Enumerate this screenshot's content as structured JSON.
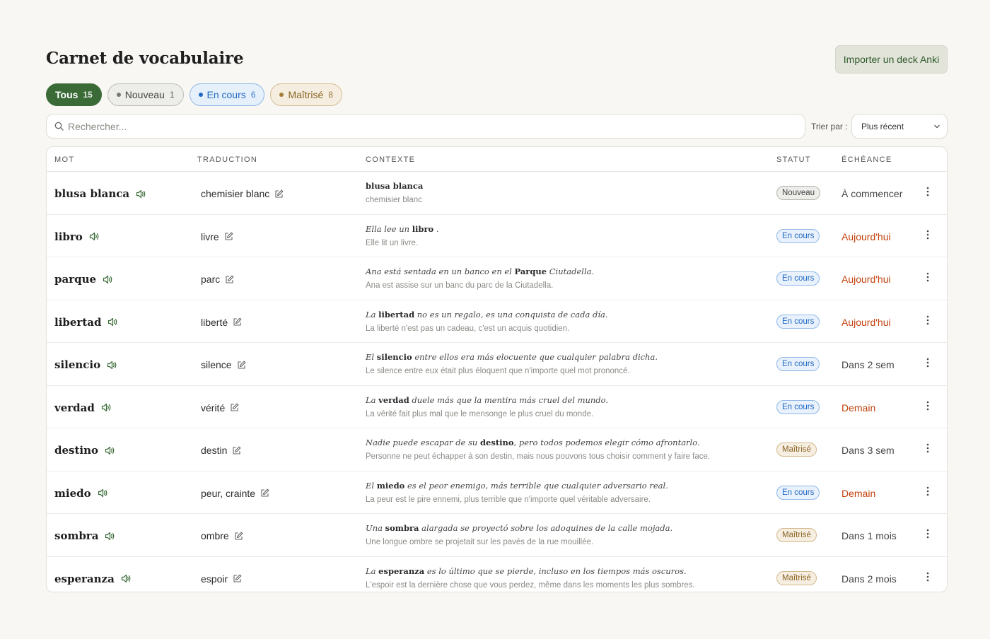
{
  "header": {
    "title": "Carnet de vocabulaire",
    "import_label": "Importer un deck Anki"
  },
  "filters": [
    {
      "label": "Tous",
      "count": "15"
    },
    {
      "label": "Nouveau",
      "count": "1"
    },
    {
      "label": "En cours",
      "count": "6"
    },
    {
      "label": "Maîtrisé",
      "count": "8"
    }
  ],
  "search": {
    "placeholder": "Rechercher..."
  },
  "sort": {
    "label": "Trier par :",
    "value": "Plus récent"
  },
  "columns": [
    "MOT",
    "TRADUCTION",
    "CONTEXTE",
    "STATUT",
    "ÉCHÉANCE"
  ],
  "rows": [
    {
      "word": "blusa blanca",
      "translation": "chemisier blanc",
      "ctx_pre": "",
      "ctx_word": "blusa blanca",
      "ctx_post": "",
      "ctx_fr": "chemisier blanc",
      "status": "Nouveau",
      "due": "À commencer"
    },
    {
      "word": "libro",
      "translation": "livre",
      "ctx_pre": "Ella lee un ",
      "ctx_word": "libro",
      "ctx_post": " .",
      "ctx_fr": "Elle lit un livre.",
      "status": "En cours",
      "due": "Aujourd'hui"
    },
    {
      "word": "parque",
      "translation": "parc",
      "ctx_pre": "Ana está sentada en un banco en el ",
      "ctx_word": "Parque",
      "ctx_post": " Ciutadella.",
      "ctx_fr": "Ana est assise sur un banc du parc de la Ciutadella.",
      "status": "En cours",
      "due": "Aujourd'hui"
    },
    {
      "word": "libertad",
      "translation": "liberté",
      "ctx_pre": "La ",
      "ctx_word": "libertad",
      "ctx_post": " no es un regalo, es una conquista de cada día.",
      "ctx_fr": "La liberté n'est pas un cadeau, c'est un acquis quotidien.",
      "status": "En cours",
      "due": "Aujourd'hui"
    },
    {
      "word": "silencio",
      "translation": "silence",
      "ctx_pre": "El ",
      "ctx_word": "silencio",
      "ctx_post": " entre ellos era más elocuente que cualquier palabra dicha.",
      "ctx_fr": "Le silence entre eux était plus éloquent que n'importe quel mot prononcé.",
      "status": "En cours",
      "due": "Dans 2 sem"
    },
    {
      "word": "verdad",
      "translation": "vérité",
      "ctx_pre": "La ",
      "ctx_word": "verdad",
      "ctx_post": " duele más que la mentira más cruel del mundo.",
      "ctx_fr": "La vérité fait plus mal que le mensonge le plus cruel du monde.",
      "status": "En cours",
      "due": "Demain"
    },
    {
      "word": "destino",
      "translation": "destin",
      "ctx_pre": "Nadie puede escapar de su ",
      "ctx_word": "destino",
      "ctx_post": ", pero todos podemos elegir cómo afrontarlo.",
      "ctx_fr": "Personne ne peut échapper à son destin, mais nous pouvons tous choisir comment y faire face.",
      "status": "Maîtrisé",
      "due": "Dans 3 sem"
    },
    {
      "word": "miedo",
      "translation": "peur, crainte",
      "ctx_pre": "El ",
      "ctx_word": "miedo",
      "ctx_post": " es el peor enemigo, más terrible que cualquier adversario real.",
      "ctx_fr": "La peur est le pire ennemi, plus terrible que n'importe quel véritable adversaire.",
      "status": "En cours",
      "due": "Demain"
    },
    {
      "word": "sombra",
      "translation": "ombre",
      "ctx_pre": "Una ",
      "ctx_word": "sombra",
      "ctx_post": " alargada se proyectó sobre los adoquines de la calle mojada.",
      "ctx_fr": "Une longue ombre se projetait sur les pavés de la rue mouillée.",
      "status": "Maîtrisé",
      "due": "Dans 1 mois"
    },
    {
      "word": "esperanza",
      "translation": "espoir",
      "ctx_pre": "La ",
      "ctx_word": "esperanza",
      "ctx_post": " es lo último que se pierde, incluso en los tiempos más oscuros.",
      "ctx_fr": "L'espoir est la dernière chose que vous perdez, même dans les moments les plus sombres.",
      "status": "Maîtrisé",
      "due": "Dans 2 mois"
    }
  ],
  "colors": {
    "accent": "#3a6b37",
    "in_progress": "#2169c4",
    "mastered": "#8a6424",
    "urgent": "#c2410c"
  },
  "icons": [
    "search-icon",
    "speaker-icon",
    "pencil-icon",
    "kebab-icon",
    "chevron-down-icon"
  ]
}
